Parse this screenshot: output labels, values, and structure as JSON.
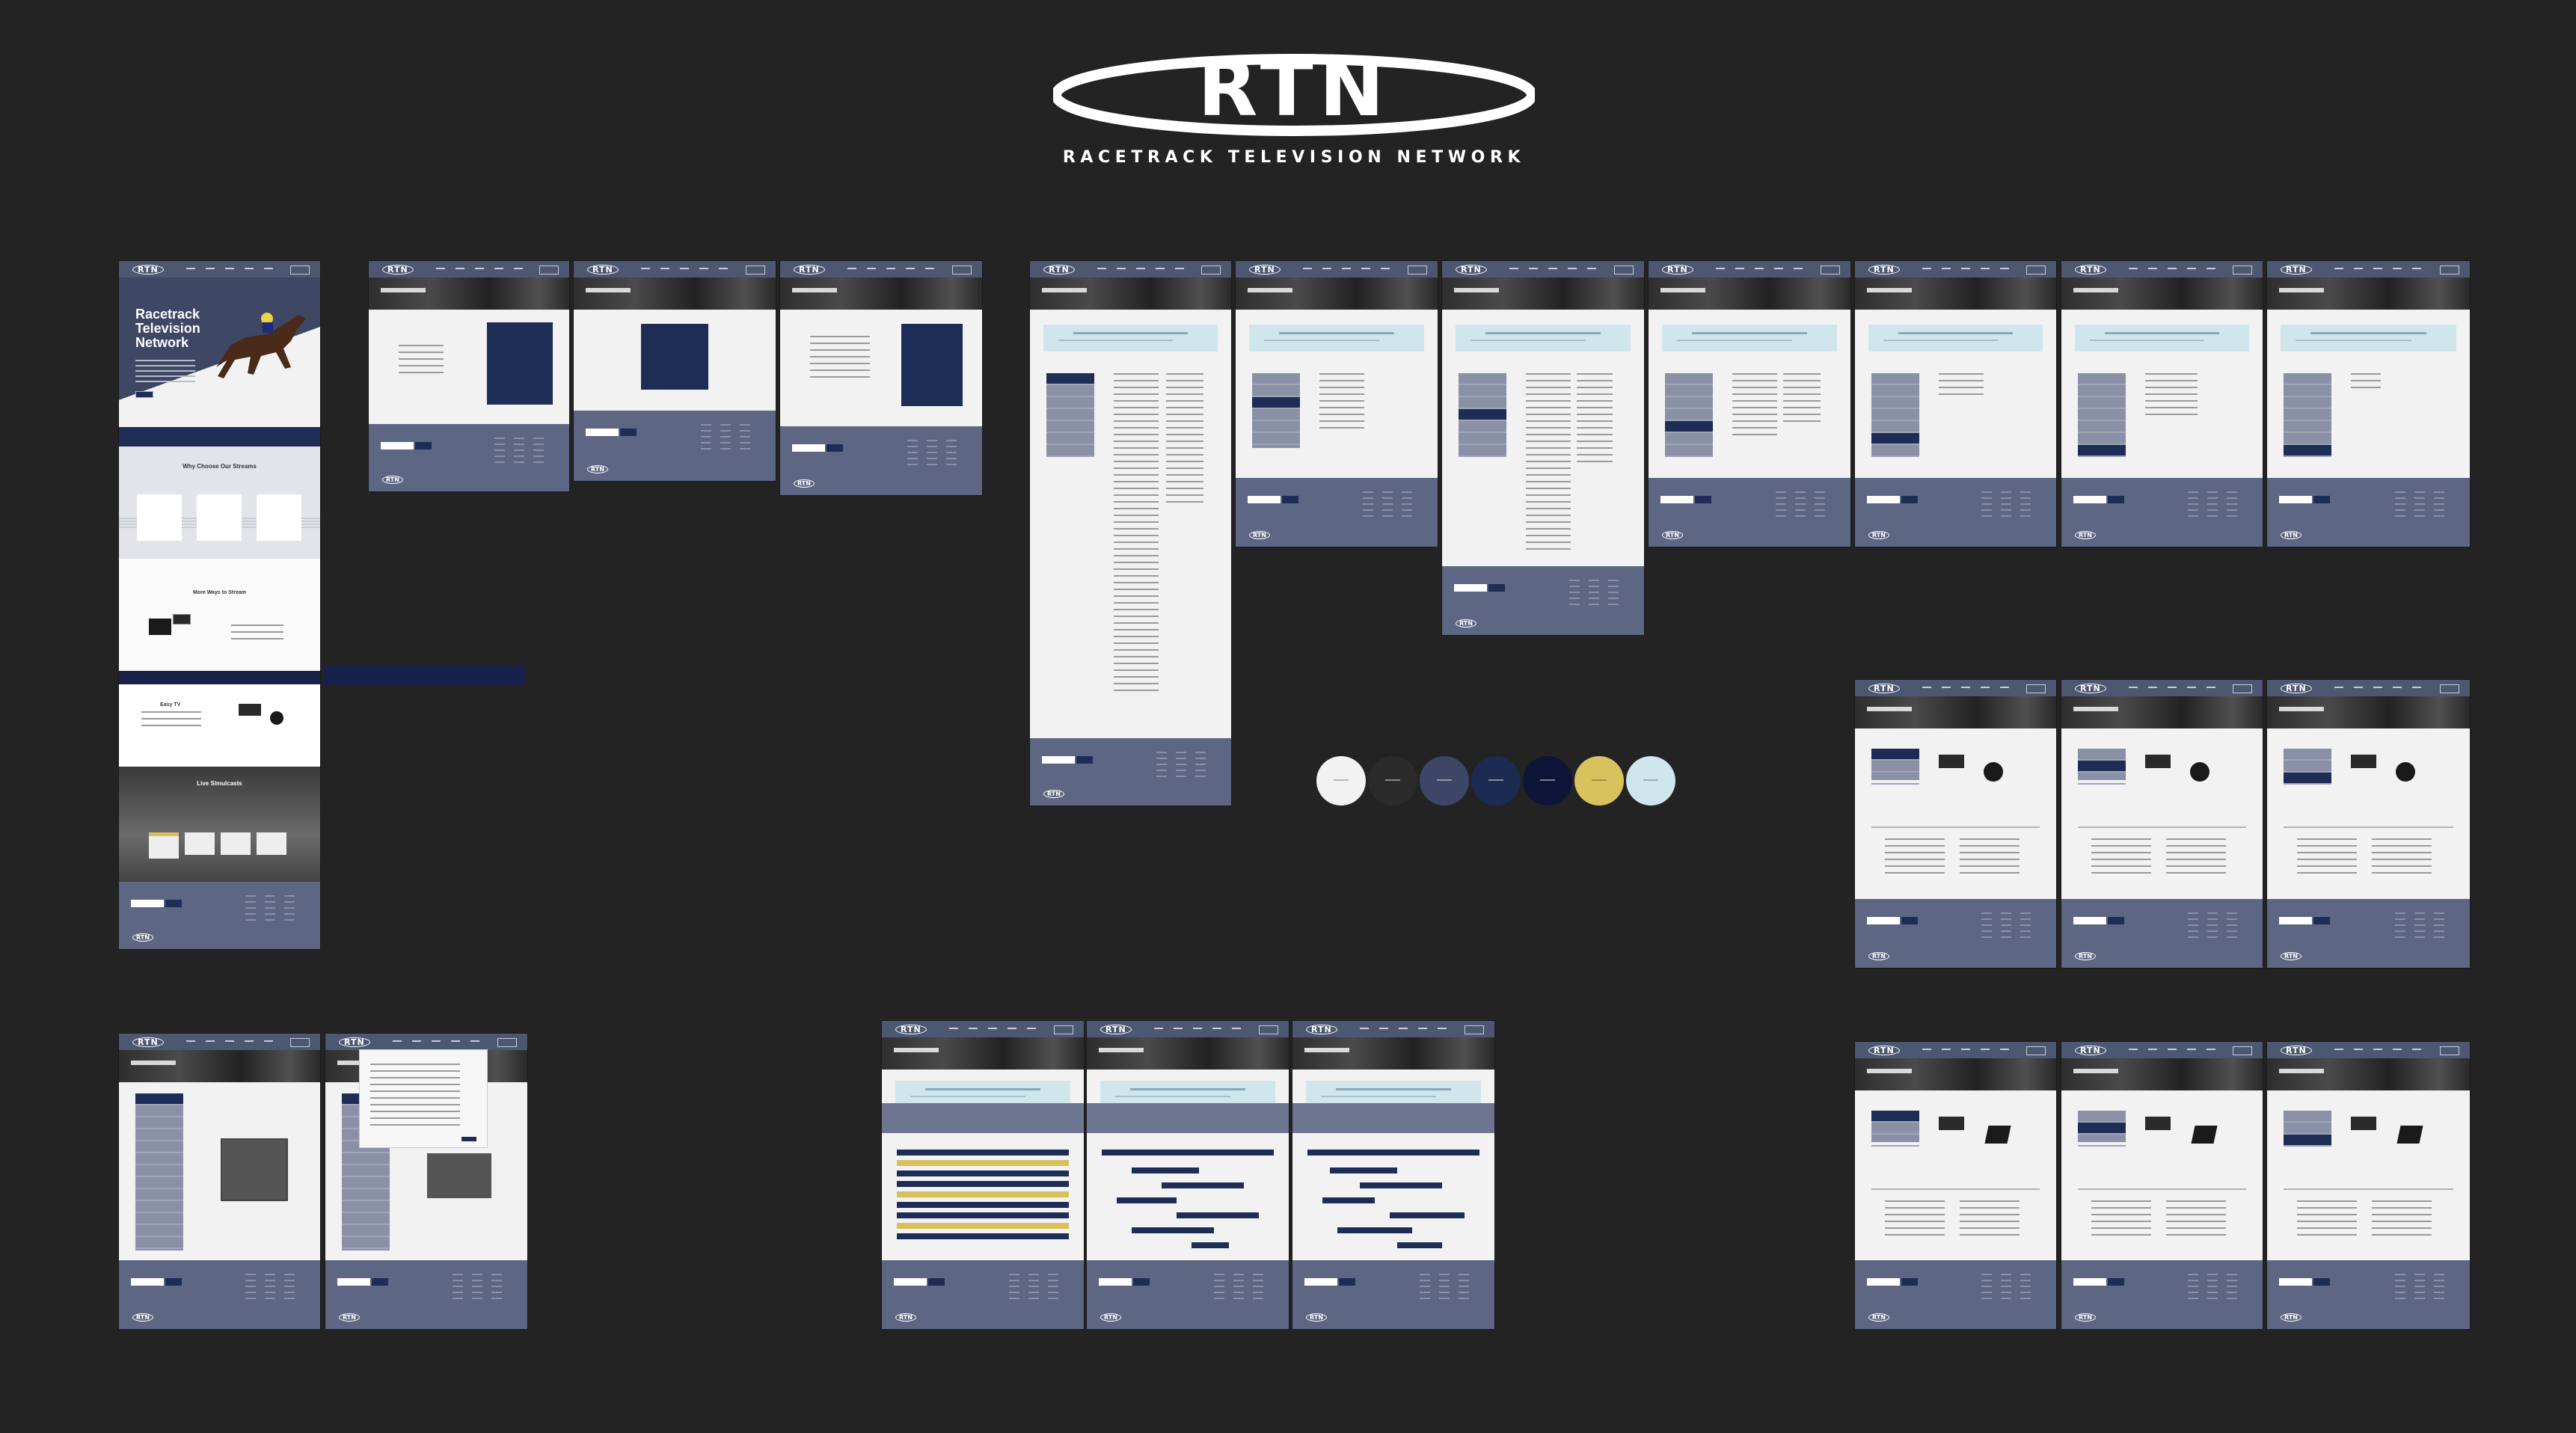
{
  "logo": {
    "wordmark": "RTN",
    "tagline": "RACETRACK TELEVISION NETWORK"
  },
  "home": {
    "hero_title_line1": "Racetrack",
    "hero_title_line2": "Television",
    "hero_title_line3": "Network",
    "why_heading": "Why Choose Our Streams",
    "more_ways_heading": "More Ways to Stream",
    "easy_heading": "Easy TV",
    "live_heading": "Live Simulcasts"
  },
  "palette": {
    "colors": [
      "#f2f2f2",
      "#2b2b2b",
      "#3d4665",
      "#1c2b52",
      "#0e1538",
      "#d8c25e",
      "#cfe6ec"
    ]
  }
}
